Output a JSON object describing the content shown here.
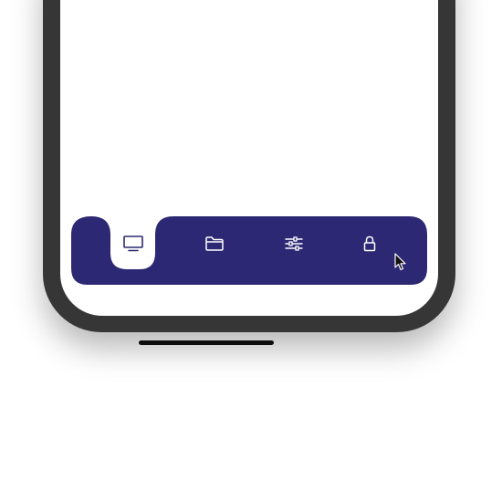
{
  "app": {
    "tabbar": {
      "color": "#2d2873",
      "active_index": 0,
      "items": [
        {
          "icon": "monitor-icon",
          "active": true
        },
        {
          "icon": "folder-icon",
          "active": false
        },
        {
          "icon": "sliders-icon",
          "active": false
        },
        {
          "icon": "lock-icon",
          "active": false
        }
      ]
    },
    "colors": {
      "phone_frame": "#363636",
      "screen": "#ffffff",
      "active_icon": "#2d2873",
      "inactive_icon": "#ffffff"
    }
  }
}
